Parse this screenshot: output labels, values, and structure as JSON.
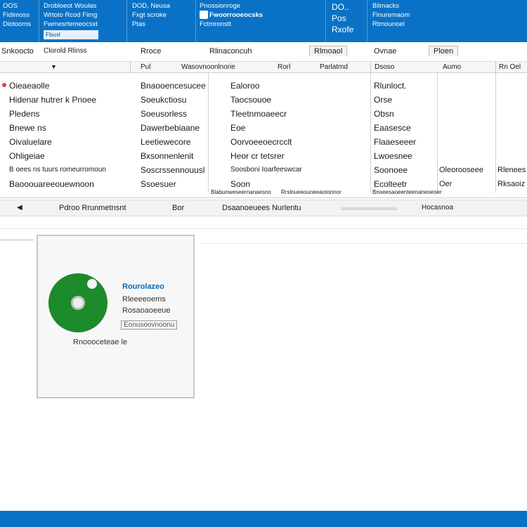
{
  "ribbon": {
    "group1": [
      "OOS",
      "Fidimoss",
      "Dlotooms"
    ],
    "group2": [
      "Drobloeot Woulas",
      "Wrtoto Rcod Fimg",
      "Fwmesrtemeocsxt"
    ],
    "group2_input": "Fbuxl",
    "group3": [
      "DOD, Neusa",
      "Fxgt scroke",
      "Ptas"
    ],
    "group4": [
      "Pnossionroge",
      "Fwoorrooeocsks",
      "Fctmronstt"
    ],
    "group5": [
      "DO..",
      "Pos",
      "Rxofe"
    ],
    "group6": [
      "Blimacks",
      "Finuremaom",
      "Rtmounoel"
    ]
  },
  "colbar": {
    "left": "Snkoocto",
    "left2": "Clorold Rlinss",
    "col1": "Rroce",
    "col2": "Rlinaconcuh",
    "col3": "Rlmoaol",
    "col4": "Ovnae",
    "col5": "Ploen"
  },
  "subrow": [
    "Pul",
    "Wasovnoonlnorie",
    "Rorl",
    "Parlatmd",
    "Dsoso",
    "Aumo",
    "Rn Oel"
  ],
  "grid": {
    "col1": [
      "Oieaeaolle",
      "Hidenar hutrer k Pnoee",
      "Pledens",
      "Bnewe ns",
      "Oivaluelare",
      "Ohligeiae",
      "B oees ns tuurs romeurromoun",
      "Baooouareeouewnoon"
    ],
    "col2": [
      "Bnaooencesucee",
      "Soeukctiosu",
      "Soeusorless",
      "Dawerbebiaane",
      "Leetiewecore",
      "Bxsonnenlenit",
      "Soscrssennouusl",
      "Ssoesuer"
    ],
    "col3": [
      "Ealoroo",
      "Taocsouoe",
      "Tleetnmoaeecr",
      "Eoe",
      "Oorvoeeoecrcclt",
      "Heor cr tetsrer",
      "Soosboni Ioarfeeswcar",
      "Soon"
    ],
    "col4": [
      "Rlunloct.",
      "Orse",
      "Obsn",
      "Eaasesce",
      "Flaaeseeer",
      "Lwoesnee",
      "Soonoee",
      "Ecolteetr"
    ],
    "col5": [
      "",
      "",
      "",
      "",
      "",
      "",
      "Oleorooseee",
      "Oer"
    ],
    "col6": [
      "",
      "",
      "",
      "",
      "",
      "",
      "Rlenees",
      "Rksaoiz"
    ]
  },
  "gridfoot": [
    "Blabunweseernanaesno",
    "Rrslnueeouneeaotonnor",
    "Bnoeesaoeenteenaneoeoer"
  ],
  "status": {
    "left": "Pdroo Rrunmetnsnt",
    "mid": "Bor",
    "right": "Dsaanoeuees Nurlentu",
    "far": "Hocasnoa"
  },
  "card": {
    "title": "Rourolazeo",
    "line1": "Rleeeeoems",
    "line2": "Rosaoaoeeue",
    "link": "Eonusoovnoonu",
    "caption": "Rnoooceteae le"
  },
  "colors": {
    "ribbon": "#0a72c6",
    "disc": "#1d8a2b",
    "card_title": "#0a6ab7"
  }
}
